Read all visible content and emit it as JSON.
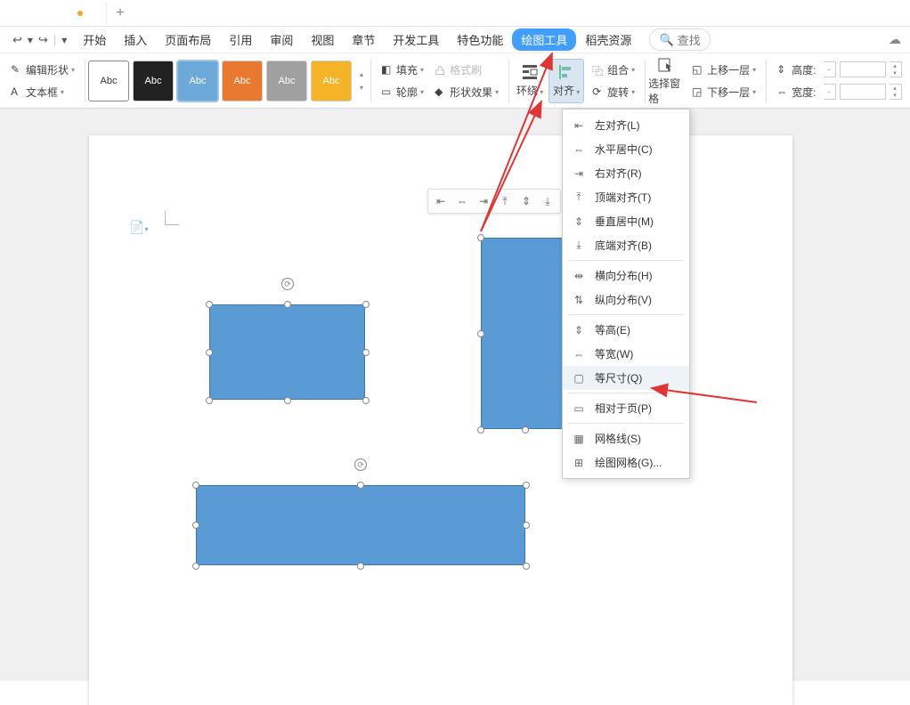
{
  "tabs": {
    "add": "+"
  },
  "menu": {
    "items": [
      "开始",
      "插入",
      "页面布局",
      "引用",
      "审阅",
      "视图",
      "章节",
      "开发工具",
      "特色功能",
      "绘图工具",
      "稻壳资源"
    ],
    "active_index": 9,
    "search": "查找"
  },
  "ribbon": {
    "edit_shape": "编辑形状",
    "text_box": "文本框",
    "swatch_label": "Abc",
    "fill": "填充",
    "outline": "轮廓",
    "format_painter": "格式刷",
    "shape_effect": "形状效果",
    "wrap": "环绕",
    "align": "对齐",
    "group": "组合",
    "rotate": "旋转",
    "select_pane": "选择窗格",
    "bring_forward": "上移一层",
    "send_backward": "下移一层",
    "height": "高度:",
    "width": "宽度:",
    "height_val": "",
    "width_val": "",
    "step_dash": "–"
  },
  "dropdown": {
    "items": [
      {
        "label": "左对齐(L)"
      },
      {
        "label": "水平居中(C)"
      },
      {
        "label": "右对齐(R)"
      },
      {
        "label": "顶端对齐(T)"
      },
      {
        "label": "垂直居中(M)"
      },
      {
        "label": "底端对齐(B)"
      },
      {
        "sep": true
      },
      {
        "label": "横向分布(H)"
      },
      {
        "label": "纵向分布(V)"
      },
      {
        "sep": true
      },
      {
        "label": "等高(E)"
      },
      {
        "label": "等宽(W)"
      },
      {
        "label": "等尺寸(Q)",
        "hover": true
      },
      {
        "sep": true
      },
      {
        "label": "相对于页(P)"
      },
      {
        "sep": true
      },
      {
        "label": "网格线(S)"
      },
      {
        "label": "绘图网格(G)..."
      }
    ]
  }
}
